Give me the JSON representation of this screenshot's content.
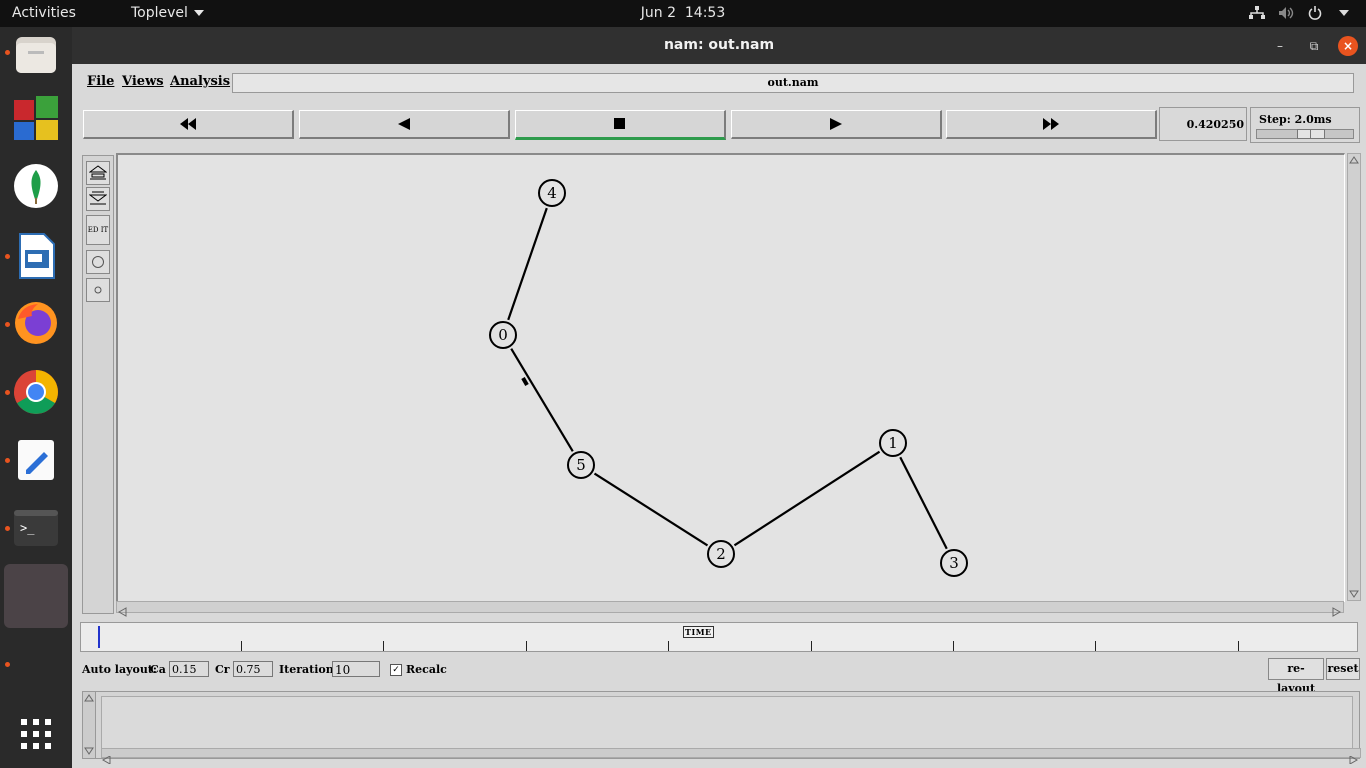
{
  "topbar": {
    "activities": "Activities",
    "app_menu": "Toplevel",
    "date": "Jun 2",
    "time": "14:53",
    "tray_icons": [
      "network-icon",
      "volume-icon",
      "power-icon",
      "chevron-down-icon"
    ]
  },
  "dock": {
    "items": [
      "files",
      "tile-app",
      "mongodb-compass",
      "libreoffice-impress",
      "firefox",
      "chrome",
      "text-editor",
      "terminal",
      "active-window"
    ],
    "apps_grid": "show-applications"
  },
  "window": {
    "title": "nam: out.nam",
    "controls": [
      "minimize",
      "maximize",
      "close"
    ]
  },
  "menu": {
    "file": "File",
    "views": "Views",
    "analysis": "Analysis"
  },
  "file_label": "out.nam",
  "playback": {
    "buttons": [
      "fast-rewind",
      "rewind",
      "stop",
      "play",
      "fast-forward"
    ],
    "active": "stop",
    "time": "0.420250",
    "step_label": "Step: 2.0ms"
  },
  "tools": {
    "edit_label": "ED IT"
  },
  "topology": {
    "nodes": [
      {
        "id": "4",
        "label": "4"
      },
      {
        "id": "0",
        "label": "0"
      },
      {
        "id": "5",
        "label": "5"
      },
      {
        "id": "2",
        "label": "2"
      },
      {
        "id": "1",
        "label": "1"
      },
      {
        "id": "3",
        "label": "3"
      }
    ],
    "links": [
      [
        "4",
        "0"
      ],
      [
        "0",
        "5"
      ],
      [
        "5",
        "2"
      ],
      [
        "2",
        "1"
      ],
      [
        "1",
        "3"
      ]
    ]
  },
  "timeline": {
    "label": "TIME"
  },
  "autolayout": {
    "label": "Auto layout:",
    "ca_label": "Ca",
    "ca_value": "0.15",
    "cr_label": "Cr",
    "cr_value": "0.75",
    "iterations_label": "Iterations",
    "iterations_value": "10",
    "recalc_label": "Recalc",
    "recalc_checked": true,
    "relayout_button": "re-layout",
    "reset_button": "reset"
  },
  "colors": {
    "topbar": "#111111",
    "dock": "#2a2a2a",
    "accent_close": "#e9541f",
    "stop_active": "#2e9b4c"
  }
}
